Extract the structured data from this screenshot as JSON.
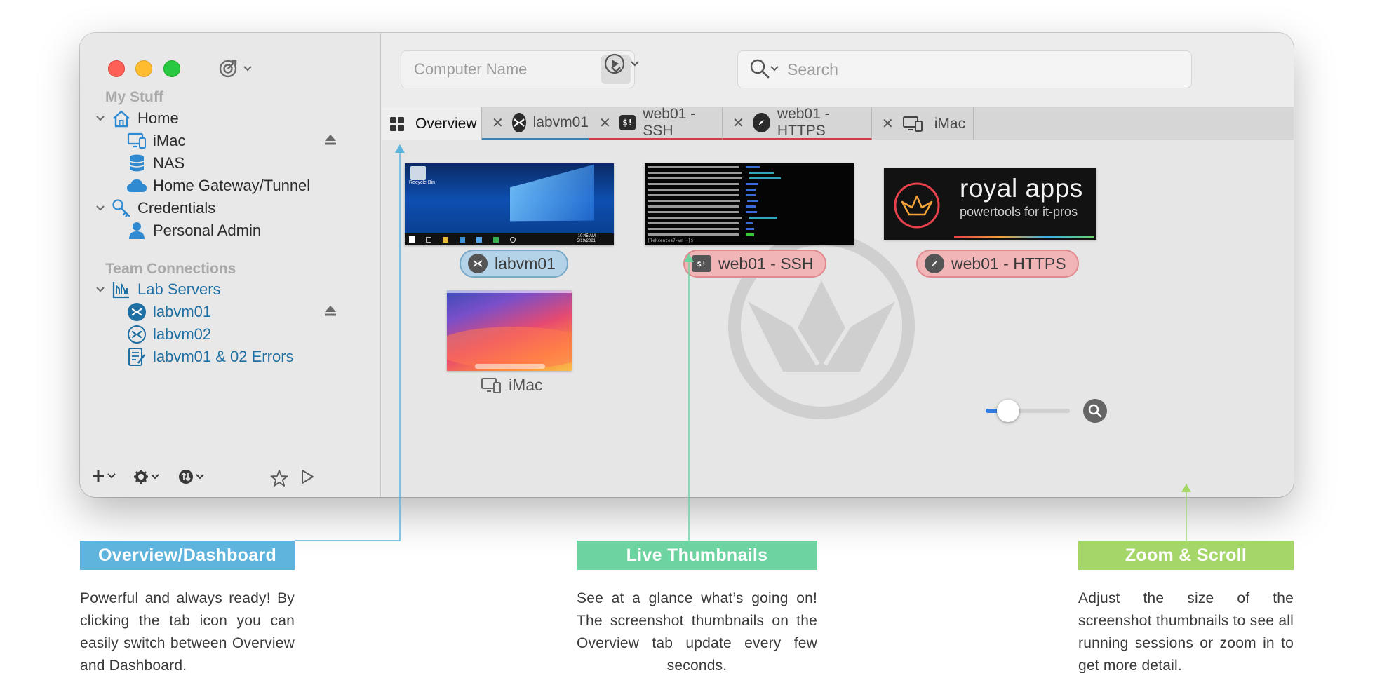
{
  "window": {
    "sidebar": {
      "my_stuff_header": "My Stuff",
      "home": "Home",
      "imac": "iMac",
      "nas": "NAS",
      "gateway": "Home Gateway/Tunnel",
      "credentials": "Credentials",
      "personal_admin": "Personal Admin",
      "team_header": "Team Connections",
      "lab_servers": "Lab Servers",
      "labvm01": "labvm01",
      "labvm02": "labvm02",
      "errors": "labvm01 & 02 Errors"
    },
    "toolbar": {
      "computer_name_placeholder": "Computer Name",
      "search_placeholder": "Search"
    },
    "tabs": [
      {
        "label": "Overview"
      },
      {
        "label": "labvm01"
      },
      {
        "label": "web01 - SSH"
      },
      {
        "label": "web01 - HTTPS"
      },
      {
        "label": "iMac"
      }
    ],
    "thumbnails": {
      "labvm01": "labvm01",
      "ssh": "web01 - SSH",
      "https": "web01 - HTTPS",
      "imac": "iMac",
      "recycle_bin": "Recycle Bin",
      "win_time": "10:45 AM",
      "win_date": "5/19/2021",
      "royal_title": "royal apps",
      "royal_subtitle": "powertools for it-pros",
      "terminal_prompt": "[TeKcentos7-vm ~]$"
    },
    "zoom": {
      "level": 0.27
    }
  },
  "callouts": {
    "overview_title": "Overview/Dashboard",
    "overview_text": "Powerful and always ready! By clicking the tab icon you can easily switch between Overview and Dashboard.",
    "live_title": "Live Thumbnails",
    "live_text": "See at a glance what’s going on! The screenshot thumbnails on the Overview tab update every few seconds.",
    "zoom_title": "Zoom & Scroll",
    "zoom_text": "Adjust the size of the screenshot thumbnails to see all running sessions or zoom in to get more detail."
  },
  "colors": {
    "rdp": "#3d80ad",
    "ssh_web": "#d13c45",
    "callout_blue": "#5fb4dd",
    "callout_green": "#6dd3a0",
    "callout_lime": "#a5d66a"
  }
}
